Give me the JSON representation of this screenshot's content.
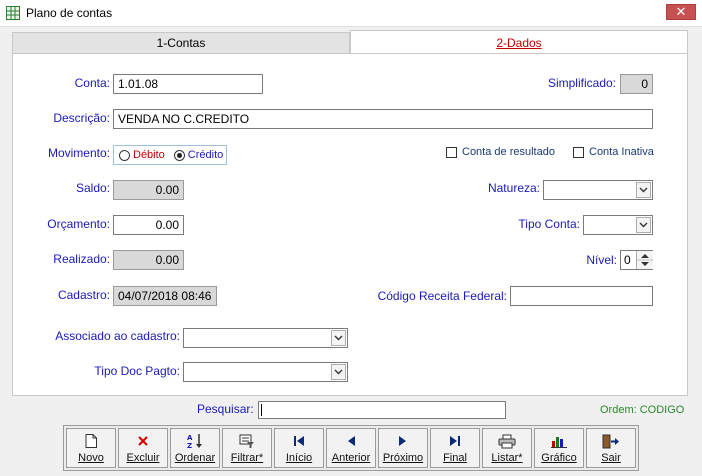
{
  "window": {
    "title": "Plano de contas",
    "close_glyph": "✕"
  },
  "tabs": [
    {
      "label": "1-Contas"
    },
    {
      "label": "2-Dados"
    }
  ],
  "form": {
    "conta_label": "Conta:",
    "conta_value": "1.01.08",
    "simplificado_label": "Simplificado:",
    "simplificado_value": "0",
    "descricao_label": "Descrição:",
    "descricao_value": "VENDA NO C.CREDITO",
    "movimento_label": "Movimento:",
    "debito_label": "Débito",
    "credito_label": "Crédito",
    "movimento_selected": "Crédito",
    "conta_resultado_label": "Conta de resultado",
    "conta_inativa_label": "Conta Inativa",
    "saldo_label": "Saldo:",
    "saldo_value": "0.00",
    "natureza_label": "Natureza:",
    "orcamento_label": "Orçamento:",
    "orcamento_value": "0.00",
    "tipo_conta_label": "Tipo Conta:",
    "realizado_label": "Realizado:",
    "realizado_value": "0.00",
    "nivel_label": "Nível:",
    "nivel_value": "0",
    "cadastro_label": "Cadastro:",
    "cadastro_value": "04/07/2018 08:46",
    "codigo_receita_label": "Código Receita Federal:",
    "associado_label": "Associado ao cadastro:",
    "tipo_doc_label": "Tipo Doc Pagto:"
  },
  "search": {
    "label": "Pesquisar:",
    "value": ""
  },
  "ordem": "Ordem: CODIGO",
  "toolbar": [
    {
      "label": "Novo",
      "icon": "new-document-icon"
    },
    {
      "label": "Excluir",
      "icon": "delete-icon"
    },
    {
      "label": "Ordenar",
      "icon": "sort-az-icon"
    },
    {
      "label": "Filtrar*",
      "icon": "filter-icon"
    },
    {
      "label": "Início",
      "icon": "first-icon"
    },
    {
      "label": "Anterior",
      "icon": "previous-icon"
    },
    {
      "label": "Próximo",
      "icon": "next-icon"
    },
    {
      "label": "Final",
      "icon": "last-icon"
    },
    {
      "label": "Listar*",
      "icon": "printer-icon"
    },
    {
      "label": "Gráfico",
      "icon": "chart-icon"
    },
    {
      "label": "Sair",
      "icon": "exit-icon"
    }
  ],
  "colors": {
    "label_blue": "#1a1ab8",
    "active_tab_red": "#c00000",
    "ordem_green": "#2a8a2a"
  }
}
